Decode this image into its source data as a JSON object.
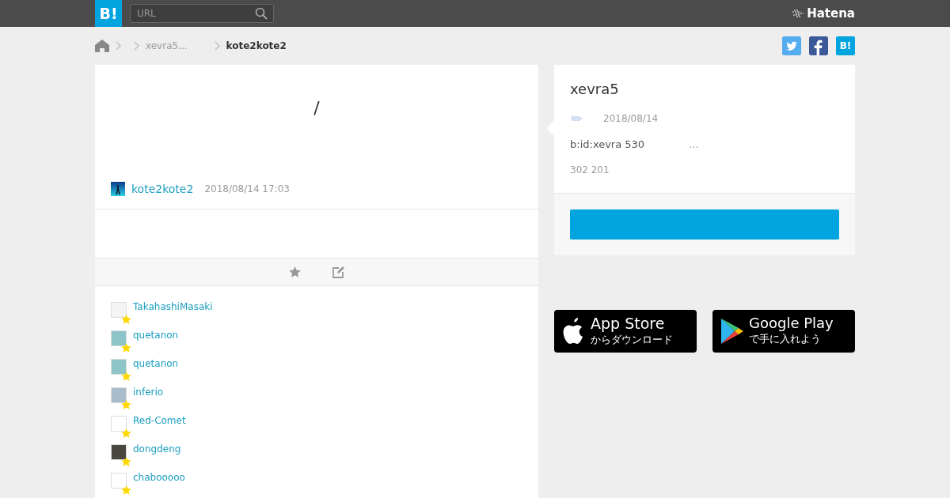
{
  "header": {
    "logo": "B!",
    "search": {
      "placeholder": "URL"
    },
    "brand": "Hatena"
  },
  "breadcrumb": {
    "items": [
      "xevra5...",
      "kote2kote2"
    ]
  },
  "share": {
    "bookmark_label": "B!"
  },
  "entry": {
    "title": "/",
    "user": "kote2kote2",
    "date": "2018/08/14 17:03"
  },
  "stars": [
    {
      "user": "TakahashiMasaki",
      "color": "#f4f4f4"
    },
    {
      "user": "quetanon",
      "color": "#8cc4c8"
    },
    {
      "user": "quetanon",
      "color": "#8cc4c8"
    },
    {
      "user": "inferio",
      "color": "#a9bccc"
    },
    {
      "user": "Red-Comet",
      "color": "#ffffff"
    },
    {
      "user": "dongdeng",
      "color": "#4a4640"
    },
    {
      "user": "chabooooo",
      "color": "#ffffff"
    }
  ],
  "profile": {
    "name": "xevra5",
    "date": "2018/08/14",
    "description": "b:id:xevra 530",
    "more": "...",
    "stats": "302 201"
  },
  "apps": [
    {
      "kind": "apple",
      "name": "App Store",
      "caption": "からダウンロード"
    },
    {
      "kind": "google",
      "name": "Google Play",
      "caption": "で手に入れよう"
    }
  ]
}
